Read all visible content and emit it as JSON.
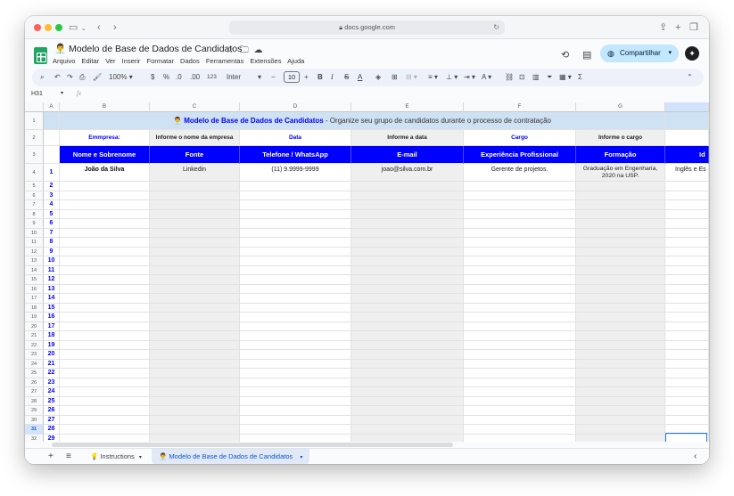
{
  "browser": {
    "url": "docs.google.com"
  },
  "doc": {
    "title": "Modelo de Base de Dados de Candidatos",
    "title_emoji": "👨‍💼",
    "menus": [
      "Arquivo",
      "Editar",
      "Ver",
      "Inserir",
      "Formatar",
      "Dados",
      "Ferramentas",
      "Extensões",
      "Ajuda"
    ],
    "share_label": "Compartilhar"
  },
  "toolbar": {
    "zoom": "100%",
    "currency": "$",
    "percent": "%",
    "dec_decrease": ".0",
    "dec_increase": ".00",
    "number_format": "123",
    "font": "Inter",
    "font_size": "10",
    "bold": "B",
    "italic": "I",
    "strike": "S",
    "text_color": "A"
  },
  "formula_bar": {
    "cell_ref": "H31",
    "fx": "fx",
    "value": ""
  },
  "sheet": {
    "columns": [
      "A",
      "B",
      "C",
      "D",
      "E",
      "F",
      "G"
    ],
    "banner_title": "Modelo de Base de Dados de Candidatos",
    "banner_subtitle": " - Organize seu grupo de candidatos durante o processo de contratação",
    "meta_row": [
      {
        "label": "Emmpresa:",
        "value": "Informe o nome da empresa"
      },
      {
        "label": "Data",
        "value": "Informe a data"
      },
      {
        "label": "Cargo",
        "value": "Informe o cargo"
      }
    ],
    "headers": [
      "Nome e Sobrenome",
      "Fonte",
      "Telefone / WhatsApp",
      "E-mail",
      "Experiência Profissional",
      "Formação",
      "Id"
    ],
    "record": {
      "index": "1",
      "name": "João da Silva",
      "source": "Linkedin",
      "phone": "(11) 9.9999-9999",
      "email": "joao@silva.com.br",
      "experience": "Gerente de projetos.",
      "education_line1": "Graduação em Engenharia,",
      "education_line2": "2020 na USP.",
      "language": "Inglês e Es"
    },
    "row_numbers": [
      "1",
      "2",
      "3",
      "4",
      "5",
      "6",
      "7",
      "8",
      "9",
      "10",
      "11",
      "12",
      "13",
      "14",
      "15",
      "16",
      "17",
      "18",
      "19",
      "20",
      "21",
      "22",
      "23",
      "24",
      "25",
      "26",
      "27",
      "28",
      "29",
      "30",
      "31",
      "32"
    ],
    "index_values": [
      "2",
      "3",
      "4",
      "5",
      "6",
      "7",
      "8",
      "9",
      "10",
      "11",
      "12",
      "13",
      "14",
      "15",
      "16",
      "17",
      "18",
      "19",
      "20",
      "21",
      "22",
      "23",
      "24",
      "25",
      "26",
      "27",
      "28",
      "29"
    ]
  },
  "tabs": {
    "add": "+",
    "list": "≡",
    "items": [
      {
        "label": "Instructions",
        "emoji": "💡"
      },
      {
        "label": "Modelo de Base de Dados de Candidatos",
        "emoji": "👨‍💼"
      }
    ]
  },
  "colors": {
    "accent_blue": "#0000ff",
    "banner_bg": "#cfe2f3",
    "share_bg": "#c2e7ff"
  }
}
